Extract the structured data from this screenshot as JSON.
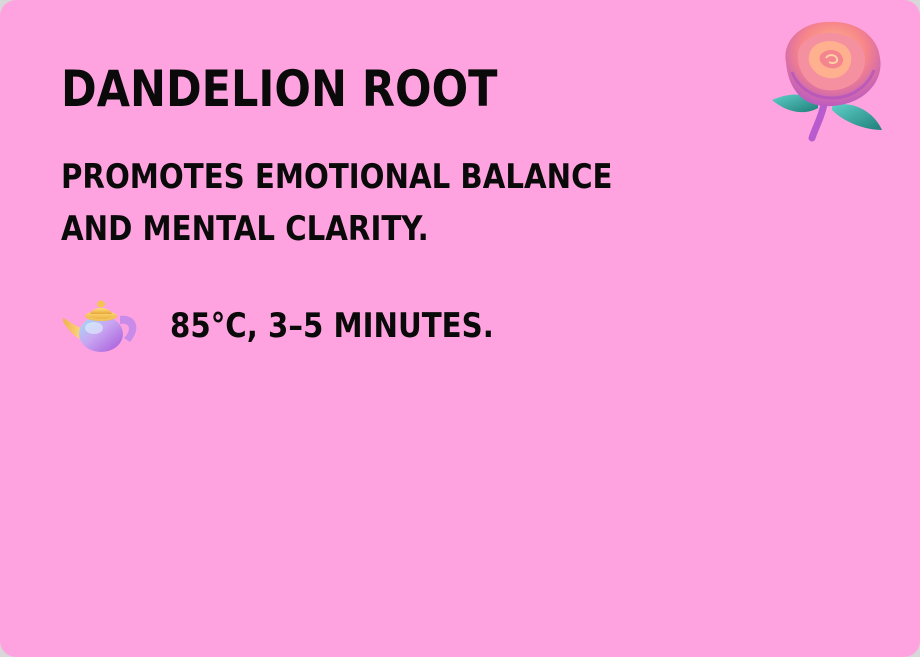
{
  "card": {
    "title": "DANDELION ROOT",
    "description_lines": [
      "PROMOTES EMOTIONAL BALANCE",
      "AND MENTAL CLARITY."
    ],
    "brew": {
      "icon": "teapot-icon",
      "text": "85°C, 3–5 MINUTES."
    },
    "decoration_icon": "rose-icon"
  },
  "colors": {
    "background": "#ffa3e0",
    "text": "#0a0a0a"
  }
}
